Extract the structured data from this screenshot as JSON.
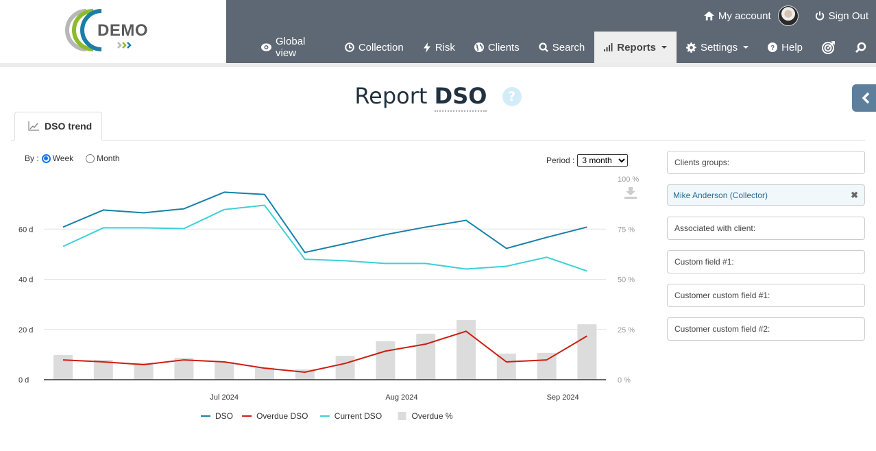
{
  "header": {
    "logo_text": "DEMO",
    "top_links": {
      "my_account": "My account",
      "sign_out": "Sign Out"
    },
    "nav": [
      {
        "label": "Global view",
        "icon": "eye-icon"
      },
      {
        "label": "Collection",
        "icon": "clock-icon"
      },
      {
        "label": "Risk",
        "icon": "bolt-icon"
      },
      {
        "label": "Clients",
        "icon": "globe-icon"
      },
      {
        "label": "Search",
        "icon": "search-icon"
      },
      {
        "label": "Reports",
        "icon": "bar-chart-icon",
        "active": true,
        "dropdown": true
      },
      {
        "label": "Settings",
        "icon": "gear-icon",
        "dropdown": true
      },
      {
        "label": "Help",
        "icon": "question-circle-icon"
      }
    ]
  },
  "page": {
    "title_prefix": "Report",
    "title_strong": "DSO",
    "help": "?",
    "tab_label": "DSO trend"
  },
  "controls": {
    "by_label": "By :",
    "by_options": [
      "Week",
      "Month"
    ],
    "by_selected": "Week",
    "period_label": "Period :",
    "period_value": "3 month"
  },
  "filters": [
    {
      "label": "Clients groups:"
    },
    {
      "label": "Mike Anderson (Collector)",
      "selected": true,
      "remove": "✖"
    },
    {
      "label": "Associated with client:"
    },
    {
      "label": "Custom field #1:"
    },
    {
      "label": "Customer custom field #1:"
    },
    {
      "label": "Customer custom field #2:"
    }
  ],
  "colors": {
    "dso": "#1580a8",
    "overdue_dso": "#cc1d10",
    "current_dso": "#3cd0d8",
    "overdue_pct": "#dcdcdc",
    "header_bg": "#5e6874"
  },
  "chart_data": {
    "type": "line",
    "title": "",
    "xlabel": "",
    "ylabel": "",
    "y_left": {
      "ticks": [
        "0 d",
        "20 d",
        "40 d",
        "60 d"
      ],
      "range": [
        0,
        80
      ]
    },
    "y_right": {
      "ticks": [
        "0 %",
        "25 %",
        "50 %",
        "75 %",
        "100 %"
      ],
      "range": [
        0,
        100
      ]
    },
    "x_ticks": [
      {
        "label": "Jul 2024",
        "index": 4
      },
      {
        "label": "Aug 2024",
        "index": 8.4
      },
      {
        "label": "Sep 2024",
        "index": 12.4
      }
    ],
    "grid": true,
    "legend_position": "bottom",
    "points_count": 14,
    "series": [
      {
        "name": "DSO",
        "kind": "line",
        "axis": "left",
        "values": [
          60.8,
          67.6,
          66.5,
          68.1,
          74.7,
          73.8,
          50.7,
          54.2,
          57.8,
          60.8,
          63.5,
          52.3,
          56.7,
          60.8
        ]
      },
      {
        "name": "Overdue DSO",
        "kind": "line",
        "axis": "left",
        "values": [
          7.9,
          7.1,
          6.0,
          7.9,
          7.1,
          4.6,
          3.0,
          6.5,
          11.4,
          14.2,
          19.3,
          7.1,
          7.9,
          17.4
        ]
      },
      {
        "name": "Current DSO",
        "kind": "line",
        "axis": "left",
        "values": [
          53.1,
          60.5,
          60.5,
          60.2,
          67.8,
          69.5,
          48.0,
          47.4,
          46.3,
          46.3,
          44.1,
          45.2,
          48.8,
          43.3
        ]
      },
      {
        "name": "Overdue %",
        "kind": "bar",
        "axis": "right",
        "values": [
          12.3,
          9.9,
          8.5,
          10.9,
          8.9,
          6.1,
          5.1,
          11.9,
          19.1,
          22.9,
          29.7,
          13.0,
          13.3,
          27.6
        ]
      }
    ]
  }
}
